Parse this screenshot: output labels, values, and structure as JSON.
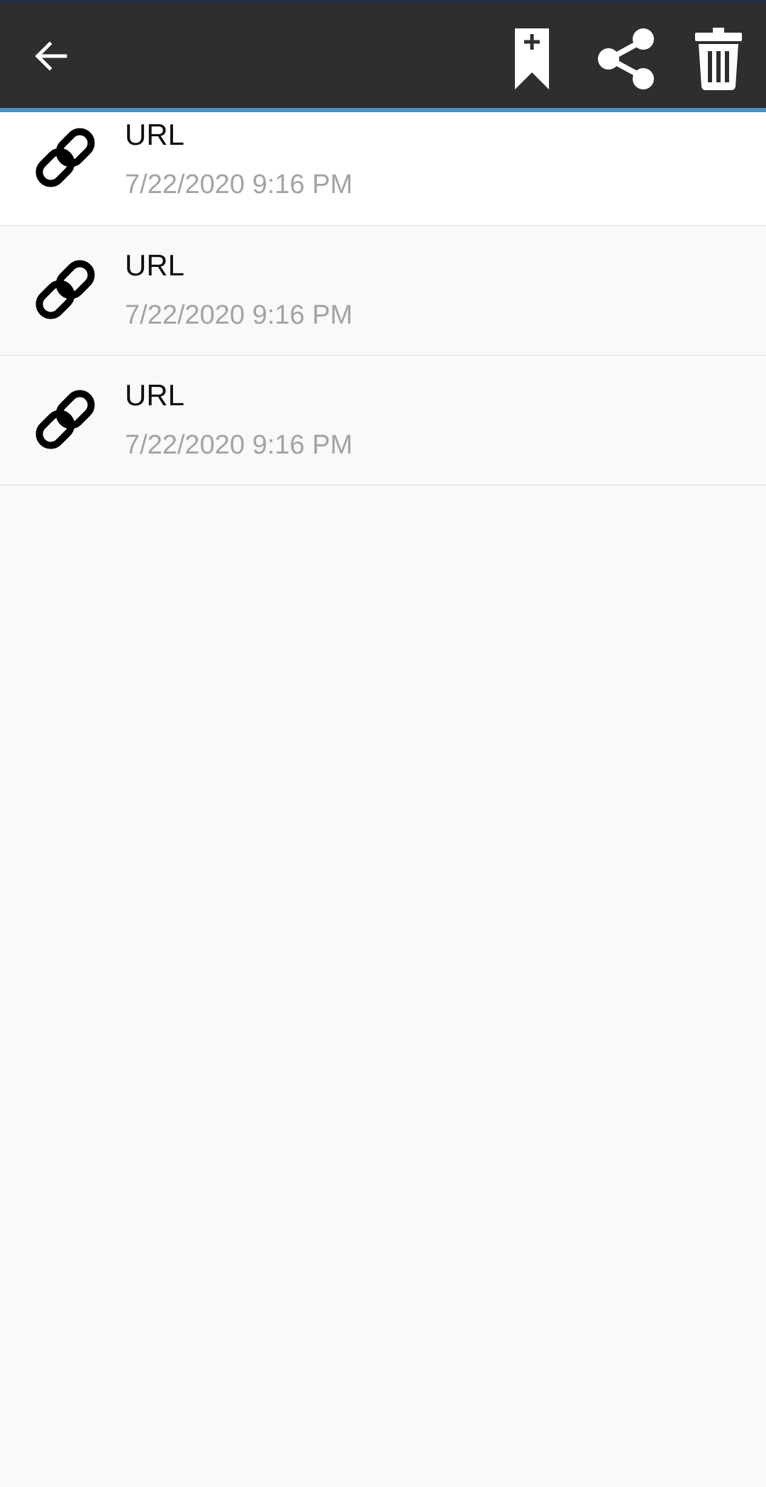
{
  "toolbar": {
    "back_icon": "arrow-left-icon",
    "actions": [
      {
        "name": "bookmark-add",
        "icon": "bookmark-plus-icon"
      },
      {
        "name": "share",
        "icon": "share-icon"
      },
      {
        "name": "delete",
        "icon": "trash-icon"
      }
    ],
    "colors": {
      "background": "#2e2e2e",
      "accent": "#3f95cc"
    }
  },
  "items": [
    {
      "title": "URL",
      "date": "7/22/2020 9:16 PM",
      "icon": "link-icon"
    },
    {
      "title": "URL",
      "date": "7/22/2020 9:16 PM",
      "icon": "link-icon"
    },
    {
      "title": "URL",
      "date": "7/22/2020 9:16 PM",
      "icon": "link-icon"
    }
  ]
}
